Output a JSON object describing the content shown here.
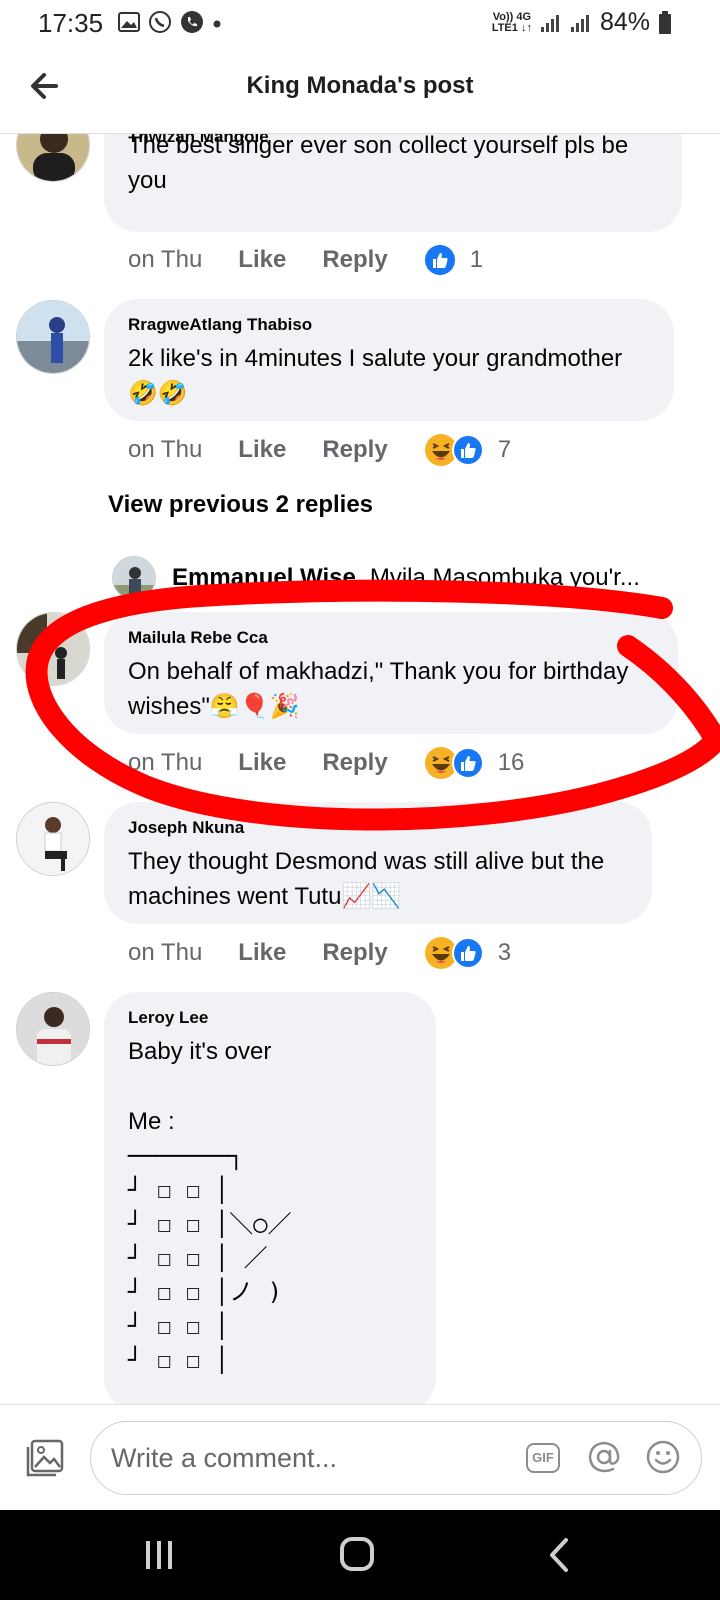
{
  "status_bar": {
    "time": "17:35",
    "battery": "84%",
    "network_top": "Vo)) 4G",
    "network_bottom": "LTE1 ↓↑"
  },
  "header": {
    "title": "King Monada's post"
  },
  "comments": [
    {
      "author": "Thwizah Mangole",
      "text_lines": [
        "The best singer ever son collect yourself pls be",
        "you"
      ],
      "time": "on Thu",
      "like": "Like",
      "reply": "Reply",
      "reactions": [
        "like"
      ],
      "count": "1"
    },
    {
      "author": "RragweAtlang Thabiso",
      "text_lines": [
        "2k like's in 4minutes I salute your grandmother",
        "🤣🤣"
      ],
      "time": "on Thu",
      "like": "Like",
      "reply": "Reply",
      "reactions": [
        "haha",
        "like"
      ],
      "count": "7"
    },
    {
      "author": "Mailula Rebe Cca",
      "text_lines": [
        "On behalf of makhadzi,\" Thank you for birthday",
        "wishes\"😤🎈🎉"
      ],
      "time": "on Thu",
      "like": "Like",
      "reply": "Reply",
      "reactions": [
        "haha",
        "like"
      ],
      "count": "16"
    },
    {
      "author": "Joseph Nkuna",
      "text_lines": [
        "They thought Desmond was still alive but the",
        "machines went Tutu📈📉"
      ],
      "time": "on Thu",
      "like": "Like",
      "reply": "Reply",
      "reactions": [
        "haha",
        "like"
      ],
      "count": "3"
    },
    {
      "author": "Leroy Lee",
      "text_lines": [
        "Baby it's over",
        "",
        "Me :"
      ],
      "ascii_art": "───────┐\n┘ ☐ ☐ │\n┘ ☐ ☐ │＼○／\n┘ ☐ ☐ │ ／\n┘ ☐ ☐ │ノ )\n┘ ☐ ☐ │\n┘ ☐ ☐ │"
    }
  ],
  "view_previous": "View previous 2 replies",
  "reply_preview": {
    "name": "Emmanuel Wise",
    "text": "Mvila Masombuka you'r..."
  },
  "compose": {
    "placeholder": "Write a comment...",
    "gif": "GIF"
  },
  "icons": {
    "back": "arrow-left",
    "photo": "image",
    "mention": "at-sign",
    "emoji": "smiley",
    "like_reaction": "thumbs-up",
    "haha_reaction": "laughing-face"
  },
  "colors": {
    "bubble": "#f0f2f5",
    "like_blue": "#1877f2",
    "haha_yellow": "#f7b125",
    "annotation_red": "#ff0000",
    "muted_text": "#65676b"
  }
}
